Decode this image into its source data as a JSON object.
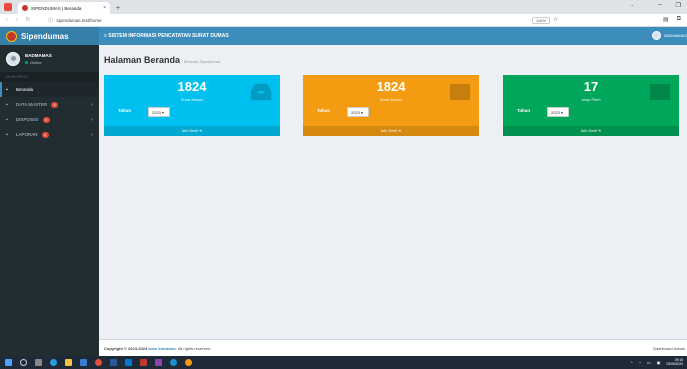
{
  "browser": {
    "tab_title": "SIPENDUMAS | Beranda",
    "tab_close": "×",
    "new_tab": "+",
    "url": "sipendumas.test/home",
    "zoom": "110%",
    "dropdown_glyph": "⌄",
    "minimize": "–",
    "restore": "❐",
    "nav_back": "‹",
    "nav_forward": "›",
    "nav_reload": "↻",
    "star": "☆"
  },
  "sidebar": {
    "logo": "Sipendumas",
    "user_name": "BADMAMAS",
    "user_status": "Online",
    "menu_header": "MAIN MENU",
    "items": [
      {
        "label": "Beranda",
        "icon": "▪",
        "badge": ""
      },
      {
        "label": "DATA MASTER",
        "icon": "▪",
        "badge": "4"
      },
      {
        "label": "DISPOSISI",
        "icon": "▪",
        "badge": "4"
      },
      {
        "label": "LAPORAN",
        "icon": "▪",
        "badge": "2"
      }
    ],
    "caret": "‹"
  },
  "navbar": {
    "title": "≡ SISTEM INFORMASI PENCATATAN SURAT DUMAS",
    "user": "BADMAMAS"
  },
  "page": {
    "title": "Halaman Beranda",
    "subtitle": "Beranda Sipendumas"
  },
  "boxes": [
    {
      "number": "1824",
      "label": "Surat Masuk",
      "year_label": "Tahun",
      "year": "2023 ▾",
      "footer": "Info Detil ➜",
      "color": "#00c0ef"
    },
    {
      "number": "1824",
      "label": "Surat Keluar",
      "year_label": "Tahun",
      "year": "2023 ▾",
      "footer": "Info Detil ➜",
      "color": "#f39c12"
    },
    {
      "number": "17",
      "label": "Arsip Pilert",
      "year_label": "Tahun",
      "year": "2023 ▾",
      "footer": "Info Detil ➜",
      "color": "#00a65a"
    }
  ],
  "footer": {
    "copyright_prefix": "Copyright © 2023-2024",
    "author": "Iwan Indrawan",
    "copyright_suffix": ". All rights reserved.",
    "right": "Dashboard Admin"
  },
  "taskbar": {
    "time": "09:15",
    "date": "03/06/2024",
    "icons": [
      "windows-icon",
      "search-icon",
      "taskview-icon",
      "edge-icon",
      "explorer-icon",
      "store-icon",
      "chrome-icon",
      "word-icon",
      "mail-icon",
      "photos-icon",
      "files-icon",
      "vscode-icon",
      "browser-icon"
    ]
  }
}
